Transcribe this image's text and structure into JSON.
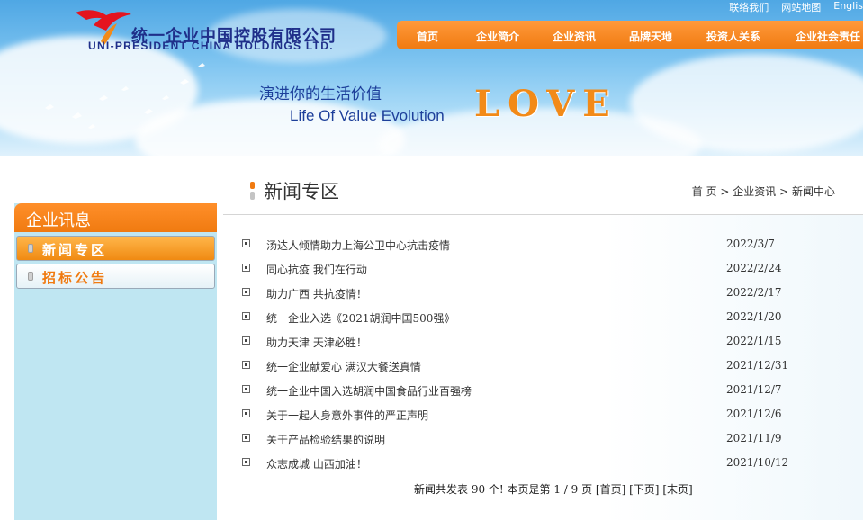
{
  "header": {
    "logo_cn": "统一企业中国控股有限公司",
    "logo_en": "UNI-PRESIDENT CHINA HOLDINGS LTD.",
    "top_links": [
      "联络我们",
      "网站地图",
      "Englis"
    ],
    "nav": [
      "首页",
      "企业简介",
      "企业资讯",
      "品牌天地",
      "投资人关系",
      "企业社会责任"
    ],
    "slogan_cn": "演进你的生活价值",
    "slogan_en": "Life Of Value Evolution",
    "slogan_love": "LOVE"
  },
  "sidebar": {
    "title": "企业讯息",
    "items": [
      "新闻专区",
      "招标公告"
    ]
  },
  "main": {
    "title": "新闻专区",
    "breadcrumb": [
      "首 页",
      " > ",
      "企业资讯",
      " > ",
      "新闻中心"
    ]
  },
  "news": [
    {
      "title": "汤达人倾情助力上海公卫中心抗击疫情",
      "date": "2022/3/7"
    },
    {
      "title": "同心抗疫 我们在行动",
      "date": "2022/2/24"
    },
    {
      "title": "助力广西 共抗疫情！",
      "date": "2022/2/17"
    },
    {
      "title": "统一企业入选《2021胡润中国500强》",
      "date": "2022/1/20"
    },
    {
      "title": "助力天津 天津必胜！",
      "date": "2022/1/15"
    },
    {
      "title": "统一企业献爱心 满汉大餐送真情",
      "date": "2021/12/31"
    },
    {
      "title": "统一企业中国入选胡润中国食品行业百强榜",
      "date": "2021/12/7"
    },
    {
      "title": "关于一起人身意外事件的严正声明",
      "date": "2021/12/6"
    },
    {
      "title": "关于产品检验结果的说明",
      "date": "2021/11/9"
    },
    {
      "title": "众志成城 山西加油！",
      "date": "2021/10/12"
    }
  ],
  "pager": {
    "summary": "新闻共发表 90 个! 本页是第 1 / 9 页 ",
    "home": "[首页]",
    "next": "[下页]",
    "last": "[末页]"
  },
  "colors": {
    "accent": "#f07a10",
    "brand_blue": "#1f2f8a",
    "sidebar_bg": "#bfe6f2"
  }
}
